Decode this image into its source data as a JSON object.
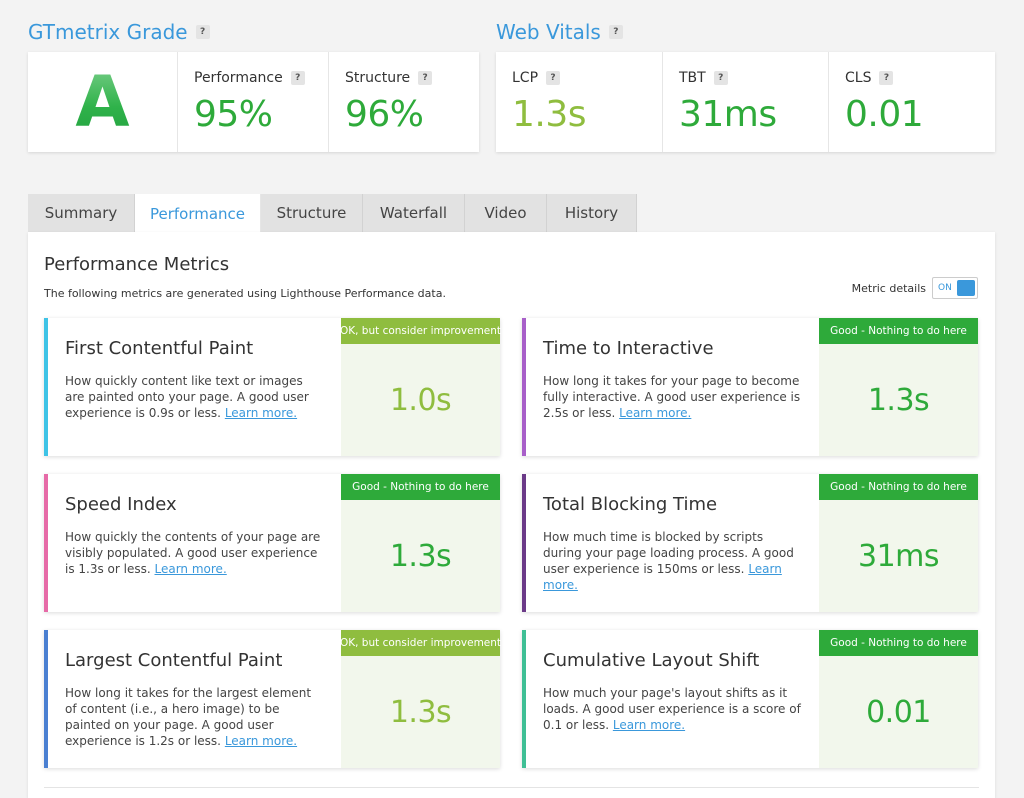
{
  "colors": {
    "accent_blue": "#3a98db",
    "good_green": "#2eaa3a",
    "ok_olive": "#8fbd3f",
    "bar_cyan": "#3ec3e6",
    "bar_purple": "#a85fc9",
    "bar_pink": "#e66aa7",
    "bar_violet": "#6b3a88",
    "bar_blue": "#4a7fd1",
    "bar_teal": "#3fbf95"
  },
  "grade": {
    "title": "GTmetrix Grade",
    "help": "?",
    "letter": "A",
    "performance": {
      "label": "Performance",
      "value": "95%"
    },
    "structure": {
      "label": "Structure",
      "value": "96%"
    }
  },
  "vitals": {
    "title": "Web Vitals",
    "help": "?",
    "lcp": {
      "label": "LCP",
      "value": "1.3s"
    },
    "tbt": {
      "label": "TBT",
      "value": "31ms"
    },
    "cls": {
      "label": "CLS",
      "value": "0.01"
    }
  },
  "tabs": [
    {
      "label": "Summary"
    },
    {
      "label": "Performance"
    },
    {
      "label": "Structure"
    },
    {
      "label": "Waterfall"
    },
    {
      "label": "Video"
    },
    {
      "label": "History"
    }
  ],
  "panel": {
    "title": "Performance Metrics",
    "description": "The following metrics are generated using Lighthouse Performance data.",
    "toggle_label": "Metric details",
    "toggle_state": "ON"
  },
  "metrics": [
    {
      "name": "First Contentful Paint",
      "desc": "How quickly content like text or images are painted onto your page. A good user experience is 0.9s or less. ",
      "learn": "Learn more.",
      "badge": "OK, but consider improvement",
      "value": "1.0s"
    },
    {
      "name": "Time to Interactive",
      "desc": "How long it takes for your page to become fully interactive. A good user experience is 2.5s or less. ",
      "learn": "Learn more.",
      "badge": "Good - Nothing to do here",
      "value": "1.3s"
    },
    {
      "name": "Speed Index",
      "desc": "How quickly the contents of your page are visibly populated. A good user experience is 1.3s or less. ",
      "learn": "Learn more.",
      "badge": "Good - Nothing to do here",
      "value": "1.3s"
    },
    {
      "name": "Total Blocking Time",
      "desc": "How much time is blocked by scripts during your page loading process. A good user experience is 150ms or less. ",
      "learn": "Learn more.",
      "badge": "Good - Nothing to do here",
      "value": "31ms"
    },
    {
      "name": "Largest Contentful Paint",
      "desc": "How long it takes for the largest element of content (i.e., a hero image) to be painted on your page. A good user experience is 1.2s or less. ",
      "learn": "Learn more.",
      "badge": "OK, but consider improvement",
      "value": "1.3s"
    },
    {
      "name": "Cumulative Layout Shift",
      "desc": "How much your page's layout shifts as it loads. A good user experience is a score of 0.1 or less. ",
      "learn": "Learn more.",
      "badge": "Good - Nothing to do here",
      "value": "0.01"
    }
  ]
}
